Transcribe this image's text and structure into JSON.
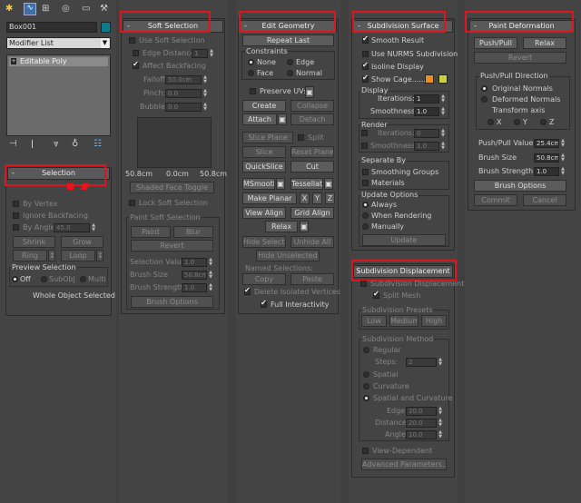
{
  "tabs": {
    "tab_create": "create-icon",
    "tab_modify": "modify-icon",
    "tab_hierarchy": "hierarchy-icon",
    "tab_motion": "motion-icon",
    "tab_display": "display-icon",
    "tab_utilities": "utilities-icon"
  },
  "modifier_panel": {
    "object_name": "Box001",
    "color_swatch": "#0c7c8c",
    "modifier_list_label": "Modifier List",
    "stack_item": "Editable Poly"
  },
  "selection": {
    "header": "Selection",
    "by_vertex": "By Vertex",
    "ignore_backfacing": "Ignore Backfacing",
    "by_angle": "By Angle:",
    "by_angle_value": "45.0",
    "shrink": "Shrink",
    "grow": "Grow",
    "ring": "Ring",
    "loop": "Loop",
    "preview_selection": "Preview Selection",
    "off": "Off",
    "subobj": "SubObj",
    "multi": "Multi",
    "status": "Whole Object Selected"
  },
  "soft_selection": {
    "header": "Soft Selection",
    "use_soft_selection": "Use Soft Selection",
    "edge_distance": "Edge Distance:",
    "edge_distance_value": "1",
    "affect_backfacing": "Affect Backfacing",
    "falloff": "Falloff:",
    "falloff_value": "50.0cm",
    "pinch": "Pinch:",
    "pinch_value": "0.0",
    "bubble": "Bubble:",
    "bubble_value": "0.0",
    "curve_left": "50.8cm",
    "curve_mid": "0.0cm",
    "curve_right": "50.8cm",
    "shaded_face_toggle": "Shaded Face Toggle",
    "lock_soft_selection": "Lock Soft Selection",
    "paint_soft_selection": "Paint Soft Selection",
    "paint": "Paint",
    "blur": "Blur",
    "revert": "Revert",
    "selection_value": "Selection Value",
    "selection_value_val": "1.0",
    "brush_size": "Brush Size",
    "brush_size_val": "50.8cm",
    "brush_strength": "Brush Strength",
    "brush_strength_val": "1.0",
    "brush_options": "Brush Options"
  },
  "edit_geometry": {
    "header": "Edit Geometry",
    "repeat_last": "Repeat Last",
    "constraints": "Constraints",
    "none": "None",
    "edge": "Edge",
    "face": "Face",
    "normal": "Normal",
    "preserve_uvs": "Preserve UVs",
    "create": "Create",
    "collapse": "Collapse",
    "attach": "Attach",
    "detach": "Detach",
    "slice_plane": "Slice Plane",
    "split": "Split",
    "slice": "Slice",
    "reset_plane": "Reset Plane",
    "quickslice": "QuickSlice",
    "cut": "Cut",
    "msmooth": "MSmooth",
    "tessellate": "Tessellate",
    "make_planar": "Make Planar",
    "x": "X",
    "y": "Y",
    "z": "Z",
    "view_align": "View Align",
    "grid_align": "Grid Align",
    "relax": "Relax",
    "hide_selected": "Hide Selected",
    "unhide_all": "Unhide All",
    "hide_unselected": "Hide Unselected",
    "named_selections": "Named Selections:",
    "copy": "Copy",
    "paste": "Paste",
    "delete_isolated": "Delete Isolated Vertices",
    "full_interactivity": "Full Interactivity"
  },
  "subdivision_surface": {
    "header": "Subdivision Surface",
    "smooth_result": "Smooth Result",
    "use_nurms": "Use NURMS Subdivision",
    "isoline_display": "Isoline Display",
    "show_cage": "Show Cage......",
    "cage_color_1": "#e8901c",
    "cage_color_2": "#c8d43c",
    "display": "Display",
    "iterations": "Iterations:",
    "iterations_val": "1",
    "smoothness": "Smoothness:",
    "smoothness_val": "1.0",
    "render": "Render",
    "render_iterations": "Iterations:",
    "render_iterations_val": "0",
    "render_smoothness": "Smoothness:",
    "render_smoothness_val": "1.0",
    "separate_by": "Separate By",
    "smoothing_groups": "Smoothing Groups",
    "materials": "Materials",
    "update_options": "Update Options",
    "always": "Always",
    "when_rendering": "When Rendering",
    "manually": "Manually",
    "update": "Update"
  },
  "subdivision_displacement": {
    "header": "Subdivision Displacement",
    "subdivision_displacement": "Subdivision Displacement",
    "split_mesh": "Split Mesh",
    "presets": "Subdivision Presets",
    "low": "Low",
    "medium": "Medium",
    "high": "High",
    "method": "Subdivision Method",
    "regular": "Regular",
    "steps": "Steps:",
    "steps_val": "2",
    "spatial": "Spatial",
    "curvature": "Curvature",
    "spatial_and_curvature": "Spatial and Curvature",
    "edge": "Edge:",
    "edge_val": "20.0",
    "distance": "Distance:",
    "distance_val": "20.0",
    "angle": "Angle:",
    "angle_val": "10.0",
    "view_dependent": "View-Dependent",
    "advanced": "Advanced Parameters..."
  },
  "paint_deformation": {
    "header": "Paint Deformation",
    "push_pull": "Push/Pull",
    "relax": "Relax",
    "revert": "Revert",
    "direction": "Push/Pull Direction",
    "original_normals": "Original Normals",
    "deformed_normals": "Deformed Normals",
    "transform_axis": "Transform axis",
    "x": "X",
    "y": "Y",
    "z": "Z",
    "push_pull_value": "Push/Pull Value",
    "push_pull_value_val": "25.4cm",
    "brush_size": "Brush Size",
    "brush_size_val": "50.8cm",
    "brush_strength": "Brush Strength",
    "brush_strength_val": "1.0",
    "brush_options": "Brush Options",
    "commit": "Commit",
    "cancel": "Cancel"
  }
}
